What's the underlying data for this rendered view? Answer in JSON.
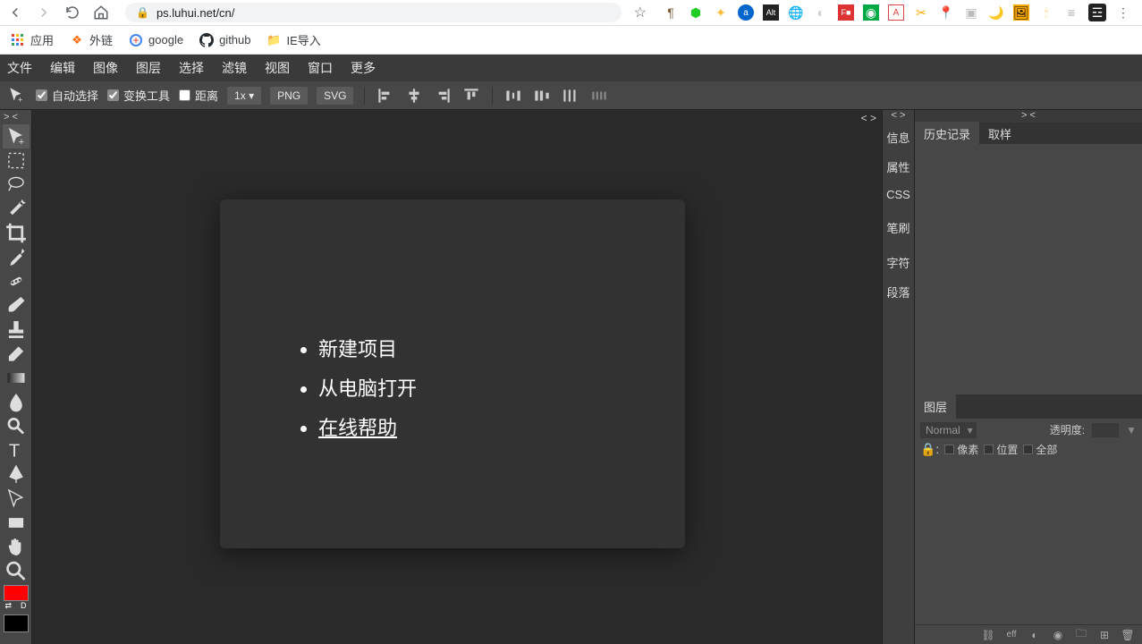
{
  "browser": {
    "url": "ps.luhui.net/cn/",
    "bookmarks": [
      {
        "label": "应用",
        "icon": "apps"
      },
      {
        "label": "外链",
        "icon": "link"
      },
      {
        "label": "google",
        "icon": "google"
      },
      {
        "label": "github",
        "icon": "github"
      },
      {
        "label": "IE导入",
        "icon": "folder"
      }
    ]
  },
  "menu": [
    "文件",
    "编辑",
    "图像",
    "图层",
    "选择",
    "滤镜",
    "视图",
    "窗口",
    "更多"
  ],
  "options": {
    "auto_select": "自动选择",
    "transform": "变换工具",
    "distance": "距离",
    "zoom": "1x",
    "png": "PNG",
    "svg": "SVG"
  },
  "welcome": {
    "new_project": "新建项目",
    "open_local": "从电脑打开",
    "online_help": "在线帮助"
  },
  "side_tabs": [
    "信息",
    "属性",
    "CSS",
    "笔刷",
    "字符",
    "段落"
  ],
  "panel1": {
    "tabs": [
      "历史记录",
      "取样"
    ],
    "active": 0
  },
  "layers": {
    "title": "图层",
    "blend": "Normal",
    "opacity_label": "透明度:",
    "lock_pixels": "像素",
    "lock_position": "位置",
    "lock_all": "全部"
  },
  "footer_eff": "eff",
  "colors": {
    "fg": "#ff0000",
    "bg": "#000000"
  }
}
